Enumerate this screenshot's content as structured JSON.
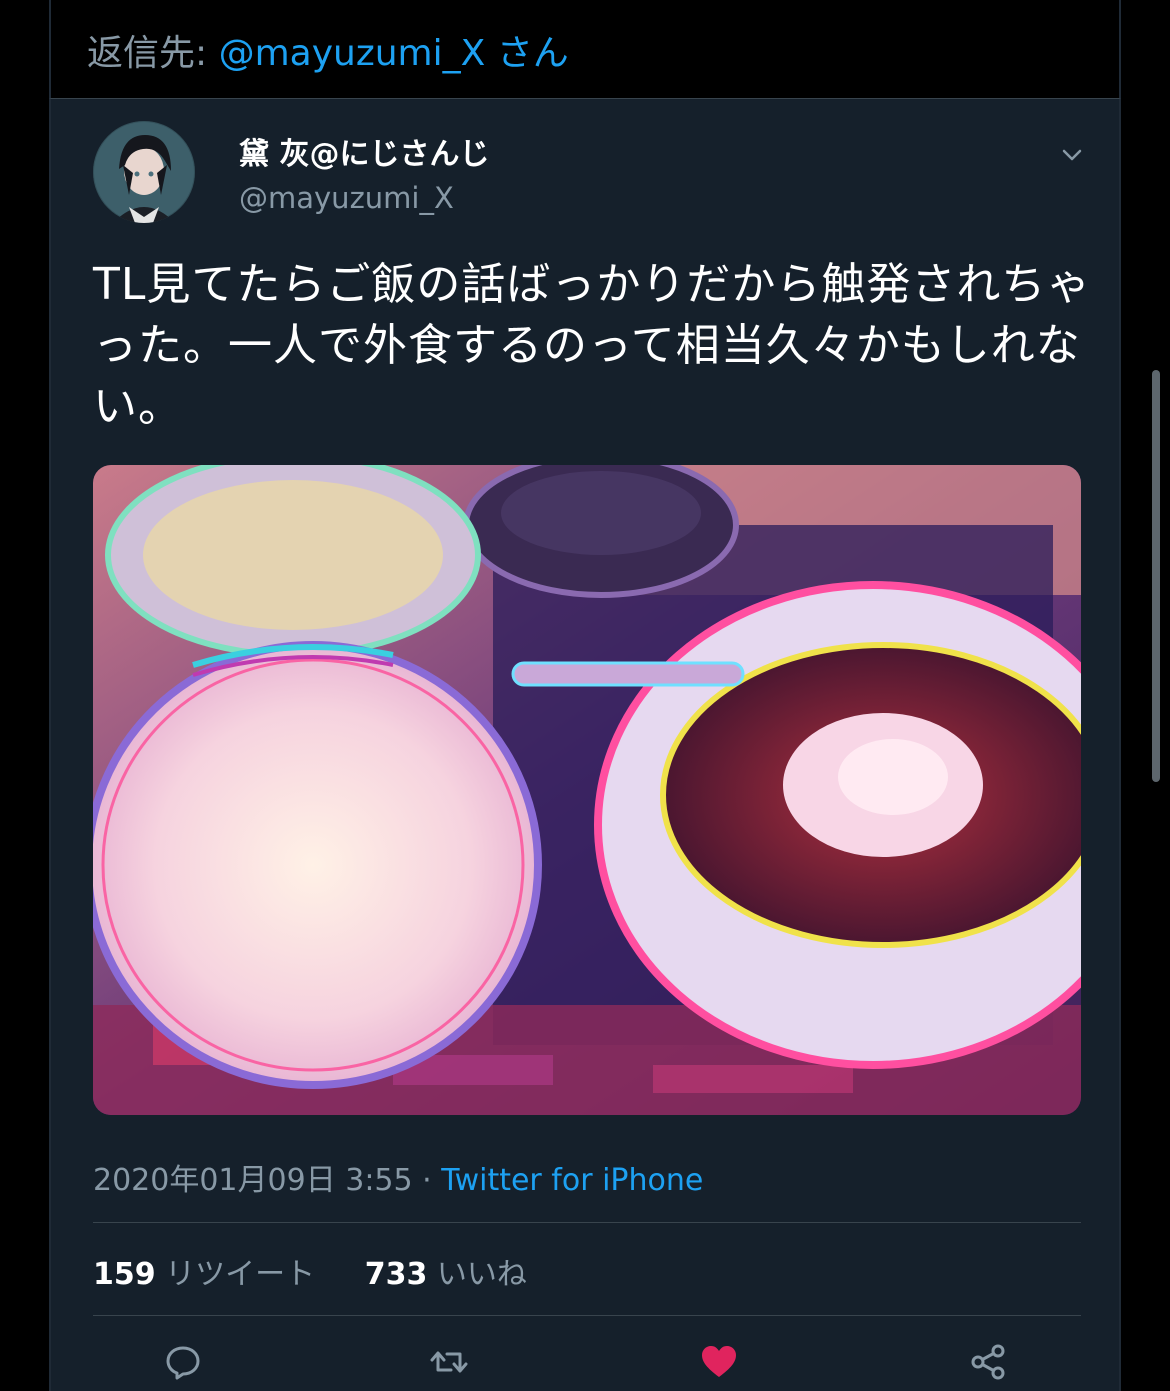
{
  "reply": {
    "prefix": "返信先: ",
    "handle": "@mayuzumi_X",
    "suffix": " さん"
  },
  "tweet": {
    "display_name": "黛 灰@にじさんじ",
    "handle": "@mayuzumi_X",
    "text": "TL見てたらご飯の話ばっかりだから触発されちゃった。一人で外食するのって相当久々かもしれない。",
    "timestamp": "2020年01月09日 3:55",
    "separator": " · ",
    "source": "Twitter for iPhone",
    "retweets_count": "159",
    "retweets_label": "リツイート",
    "likes_count": "733",
    "likes_label": "いいね"
  },
  "icons": {
    "reply": "reply-icon",
    "retweet": "retweet-icon",
    "like": "heart-icon",
    "share": "share-icon",
    "caret": "chevron-down-icon"
  },
  "colors": {
    "background": "#15202b",
    "accent": "#1da1f2",
    "muted": "#8899a6",
    "like": "#e0245e"
  }
}
